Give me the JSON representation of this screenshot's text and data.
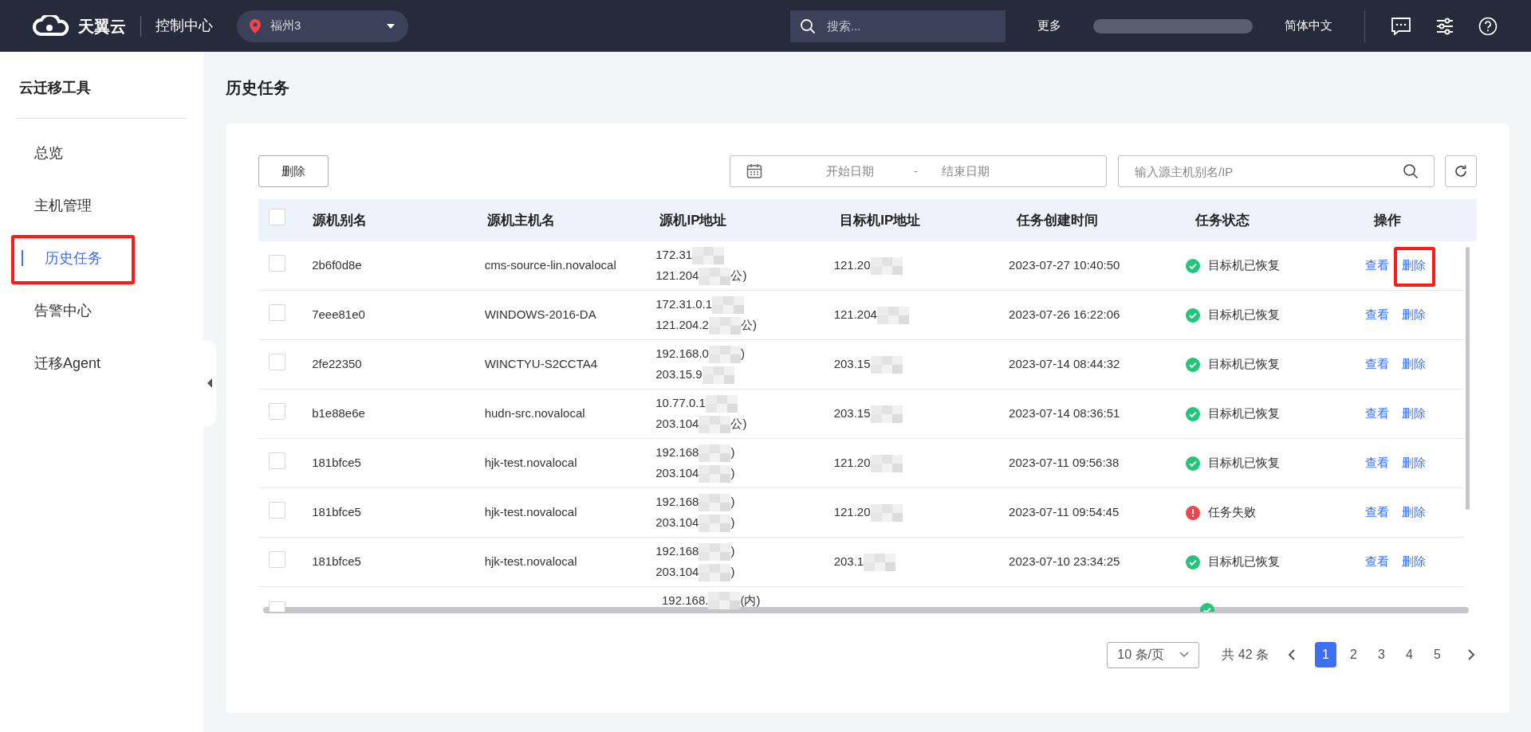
{
  "header": {
    "brand": "天翼云",
    "console": "控制中心",
    "region": "福州3",
    "search_placeholder": "搜索...",
    "more": "更多",
    "language": "简体中文"
  },
  "sidebar": {
    "title": "云迁移工具",
    "items": [
      {
        "label": "总览",
        "selected": false,
        "highlighted": false
      },
      {
        "label": "主机管理",
        "selected": false,
        "highlighted": false
      },
      {
        "label": "历史任务",
        "selected": true,
        "highlighted": true
      },
      {
        "label": "告警中心",
        "selected": false,
        "highlighted": false
      },
      {
        "label": "迁移Agent",
        "selected": false,
        "highlighted": false
      }
    ]
  },
  "page_title": "历史任务",
  "toolbar": {
    "delete_button": "删除",
    "start_date_placeholder": "开始日期",
    "date_separator": "-",
    "end_date_placeholder": "结束日期",
    "search_placeholder": "输入源主机别名/IP"
  },
  "table": {
    "columns": [
      "源机别名",
      "源机主机名",
      "源机IP地址",
      "目标机IP地址",
      "任务创建时间",
      "任务状态",
      "操作"
    ],
    "rows": [
      {
        "checked": false,
        "alias": "2b6f0d8e",
        "hostname": "cms-source-lin.novalocal",
        "source_ip": [
          [
            "172.31"
          ],
          [
            "121.204",
            "公)"
          ]
        ],
        "target_ip": "121.20",
        "created": "2023-07-27 10:40:50",
        "kind": "success",
        "status": "目标机已恢复",
        "actions": [
          {
            "label": "查看",
            "highlighted": false
          },
          {
            "label": "删除",
            "highlighted": true
          }
        ]
      },
      {
        "checked": false,
        "alias": "7eee81e0",
        "hostname": "WINDOWS-2016-DA",
        "source_ip": [
          [
            "172.31.0.1"
          ],
          [
            "121.204.2",
            "公)"
          ]
        ],
        "target_ip": "121.204",
        "created": "2023-07-26 16:22:06",
        "kind": "success",
        "status": "目标机已恢复",
        "actions": [
          {
            "label": "查看",
            "highlighted": false
          },
          {
            "label": "删除",
            "highlighted": false
          }
        ]
      },
      {
        "checked": false,
        "alias": "2fe22350",
        "hostname": "WINCTYU-S2CCTA4",
        "source_ip": [
          [
            "192.168.0",
            ")"
          ],
          [
            "203.15.9"
          ]
        ],
        "target_ip": "203.15",
        "created": "2023-07-14 08:44:32",
        "kind": "success",
        "status": "目标机已恢复",
        "actions": [
          {
            "label": "查看",
            "highlighted": false
          },
          {
            "label": "删除",
            "highlighted": false
          }
        ]
      },
      {
        "checked": false,
        "alias": "b1e88e6e",
        "hostname": "hudn-src.novalocal",
        "source_ip": [
          [
            "10.77.0.1"
          ],
          [
            "203.104",
            "公)"
          ]
        ],
        "target_ip": "203.15",
        "created": "2023-07-14 08:36:51",
        "kind": "success",
        "status": "目标机已恢复",
        "actions": [
          {
            "label": "查看",
            "highlighted": false
          },
          {
            "label": "删除",
            "highlighted": false
          }
        ]
      },
      {
        "checked": false,
        "alias": "181bfce5",
        "hostname": "hjk-test.novalocal",
        "source_ip": [
          [
            "192.168",
            ")"
          ],
          [
            "203.104",
            ")"
          ]
        ],
        "target_ip": "121.20",
        "created": "2023-07-11 09:56:38",
        "kind": "success",
        "status": "目标机已恢复",
        "actions": [
          {
            "label": "查看",
            "highlighted": false
          },
          {
            "label": "删除",
            "highlighted": false
          }
        ]
      },
      {
        "checked": false,
        "alias": "181bfce5",
        "hostname": "hjk-test.novalocal",
        "source_ip": [
          [
            "192.168",
            ")"
          ],
          [
            "203.104",
            ")"
          ]
        ],
        "target_ip": "121.20",
        "created": "2023-07-11 09:54:45",
        "kind": "failed",
        "status": "任务失败",
        "actions": [
          {
            "label": "查看",
            "highlighted": false
          },
          {
            "label": "删除",
            "highlighted": false
          }
        ]
      },
      {
        "checked": false,
        "alias": "181bfce5",
        "hostname": "hjk-test.novalocal",
        "source_ip": [
          [
            "192.168",
            ")"
          ],
          [
            "203.104",
            ")"
          ]
        ],
        "target_ip": "203.1",
        "created": "2023-07-10 23:34:25",
        "kind": "success",
        "status": "目标机已恢复",
        "actions": [
          {
            "label": "查看",
            "highlighted": false
          },
          {
            "label": "删除",
            "highlighted": false
          }
        ]
      }
    ],
    "select_all_checked": false,
    "partial_row": {
      "checked": false,
      "source_ip": [
        "192.168.",
        "(内)"
      ],
      "kind": "success"
    }
  },
  "pagination": {
    "page_size": "10 条/页",
    "total": "共 42 条",
    "pages": [
      {
        "label": "1",
        "selected": true
      },
      {
        "label": "2",
        "selected": false
      },
      {
        "label": "3",
        "selected": false
      },
      {
        "label": "4",
        "selected": false
      },
      {
        "label": "5",
        "selected": false
      }
    ]
  }
}
